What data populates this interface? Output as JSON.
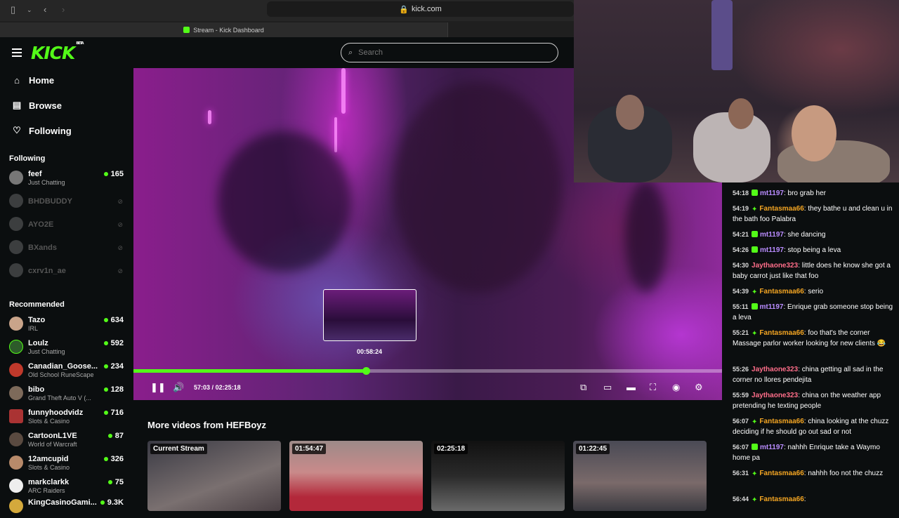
{
  "browser": {
    "url": "kick.com",
    "tab_title": "Stream - Kick Dashboard"
  },
  "brand": {
    "logo": "KICK",
    "beta": "BETA",
    "accent": "#53fc18"
  },
  "nav": [
    {
      "label": "Home",
      "icon": "home-icon"
    },
    {
      "label": "Browse",
      "icon": "browse-icon"
    },
    {
      "label": "Following",
      "icon": "heart-icon"
    }
  ],
  "search": {
    "placeholder": "Search"
  },
  "following": {
    "title": "Following",
    "channels": [
      {
        "name": "feef",
        "category": "Just Chatting",
        "viewers": "165",
        "live": true
      },
      {
        "name": "BHDBUDDY",
        "live": false
      },
      {
        "name": "AYO2E",
        "live": false
      },
      {
        "name": "BXands",
        "live": false
      },
      {
        "name": "cxrv1n_ae",
        "live": false
      }
    ]
  },
  "recommended": {
    "title": "Recommended",
    "channels": [
      {
        "name": "Tazo",
        "category": "IRL",
        "viewers": "634"
      },
      {
        "name": "Loulz",
        "category": "Just Chatting",
        "viewers": "592"
      },
      {
        "name": "Canadian_Goose...",
        "category": "Old School RuneScape",
        "viewers": "234"
      },
      {
        "name": "bibo",
        "category": "Grand Theft Auto V (...",
        "viewers": "128"
      },
      {
        "name": "funnyhoodvidz",
        "category": "Slots & Casino",
        "viewers": "716"
      },
      {
        "name": "CartoonL1VE",
        "category": "World of Warcraft",
        "viewers": "87"
      },
      {
        "name": "12amcupid",
        "category": "Slots & Casino",
        "viewers": "326"
      },
      {
        "name": "markclarkk",
        "category": "ARC Raiders",
        "viewers": "75"
      },
      {
        "name": "KingCasinoGami...",
        "category": "",
        "viewers": "9.3K"
      }
    ]
  },
  "player": {
    "preview_time": "00:58:24",
    "current_time": "57:03",
    "separator": "/",
    "duration": "02:25:18",
    "progress": 0.395
  },
  "chat": [
    {
      "time": "54:18",
      "badge": "sub",
      "user": "mt1197",
      "color": "#b98cff",
      "text": "bro grab her"
    },
    {
      "time": "54:19",
      "badge": "star",
      "user": "Fantasmaa66",
      "color": "#f5a623",
      "text": "they bathe u and clean u in the bath foo Palabra"
    },
    {
      "time": "54:21",
      "badge": "sub",
      "user": "mt1197",
      "color": "#b98cff",
      "text": "she dancing"
    },
    {
      "time": "54:26",
      "badge": "sub",
      "user": "mt1197",
      "color": "#b98cff",
      "text": "stop being a leva"
    },
    {
      "time": "54:30",
      "badge": "",
      "user": "Jaythaone323",
      "color": "#ff6e8a",
      "text": "little does he know she got a baby carrot just like that foo"
    },
    {
      "time": "54:39",
      "badge": "star",
      "user": "Fantasmaa66",
      "color": "#f5a623",
      "text": "serio"
    },
    {
      "time": "55:11",
      "badge": "sub",
      "user": "mt1197",
      "color": "#b98cff",
      "text": "Enrique grab someone stop being a leva"
    },
    {
      "time": "55:21",
      "badge": "star",
      "user": "Fantasmaa66",
      "color": "#f5a623",
      "text": "foo that's the corner Massage parlor worker looking for new clients 😂"
    },
    {
      "time": "55:26",
      "badge": "",
      "user": "Jaythaone323",
      "color": "#ff6e8a",
      "text": "china getting all sad in the corner no llores pendejita"
    },
    {
      "time": "55:59",
      "badge": "",
      "user": "Jaythaone323",
      "color": "#ff6e8a",
      "text": "china on the weather app pretending he texting people"
    },
    {
      "time": "56:07",
      "badge": "star",
      "user": "Fantasmaa66",
      "color": "#f5a623",
      "text": "china looking at the chuzz deciding if he should go out sad or not"
    },
    {
      "time": "56:07",
      "badge": "sub",
      "user": "mt1197",
      "color": "#b98cff",
      "text": "nahhh Enrique take a Waymo home pa"
    },
    {
      "time": "56:31",
      "badge": "star",
      "user": "Fantasmaa66",
      "color": "#f5a623",
      "text": "nahhh foo not the chuzz"
    },
    {
      "time": "56:44",
      "badge": "star",
      "user": "Fantasmaa66",
      "color": "#f5a623",
      "text": ""
    }
  ],
  "more_videos": {
    "title": "More videos from HEFBoyz",
    "items": [
      {
        "badge": "Current Stream"
      },
      {
        "badge": "01:54:47"
      },
      {
        "badge": "02:25:18"
      },
      {
        "badge": "01:22:45"
      }
    ]
  }
}
